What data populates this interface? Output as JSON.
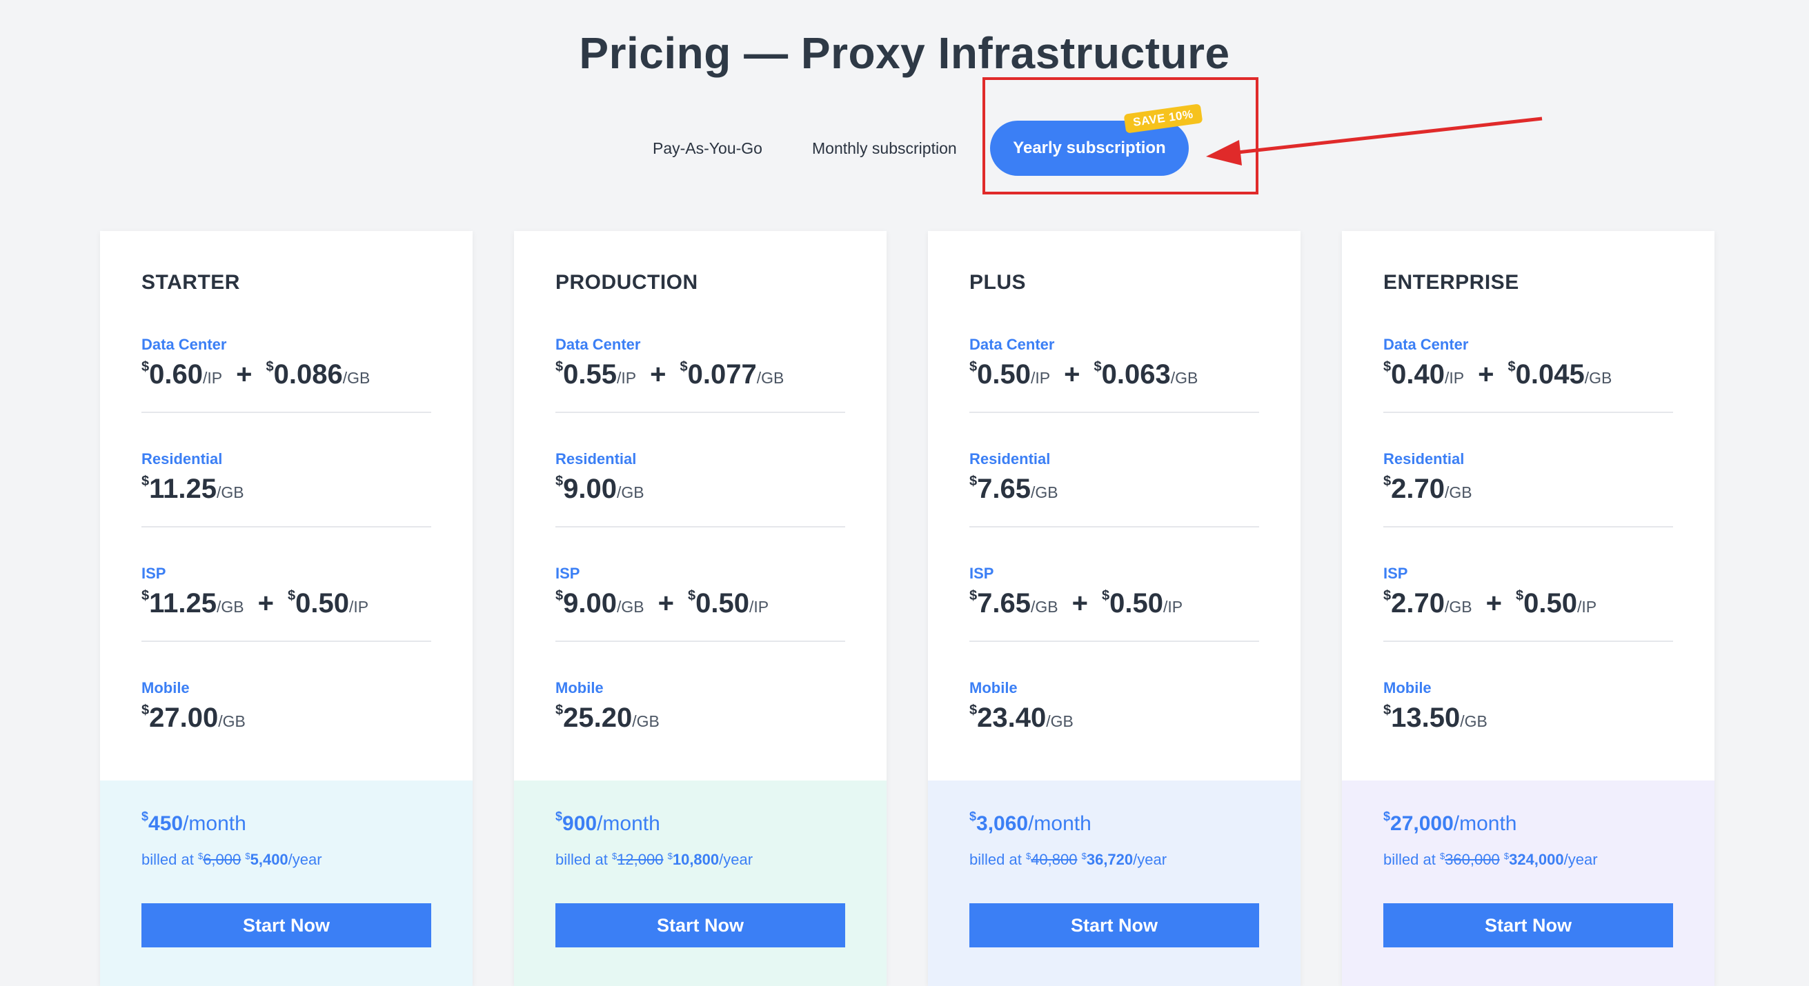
{
  "page": {
    "title": "Pricing — Proxy Infrastructure"
  },
  "tabs": {
    "payg": "Pay-As-You-Go",
    "monthly": "Monthly subscription",
    "yearly": "Yearly subscription",
    "badge": "SAVE 10%",
    "active": "yearly"
  },
  "colors": {
    "accent": "#3b7ff5",
    "badge": "#f6c21d",
    "annotation": "#e02a2a"
  },
  "labels": {
    "datacenter": "Data Center",
    "residential": "Residential",
    "isp": "ISP",
    "mobile": "Mobile",
    "currency": "$",
    "per_ip": "/IP",
    "per_gb": "/GB",
    "plus": "+",
    "per_month": "/month",
    "per_year": "/year",
    "billed_at": "billed at ",
    "cta": "Start Now"
  },
  "plans": [
    {
      "name": "STARTER",
      "bg": "#e8f7fb",
      "datacenter": {
        "ip": "0.60",
        "gb": "0.086"
      },
      "residential": {
        "gb": "11.25"
      },
      "isp": {
        "gb": "11.25",
        "ip": "0.50"
      },
      "mobile": {
        "gb": "27.00"
      },
      "monthly": "450",
      "old_year": "6,000",
      "new_year": "5,400"
    },
    {
      "name": "PRODUCTION",
      "bg": "#e6f8f3",
      "datacenter": {
        "ip": "0.55",
        "gb": "0.077"
      },
      "residential": {
        "gb": "9.00"
      },
      "isp": {
        "gb": "9.00",
        "ip": "0.50"
      },
      "mobile": {
        "gb": "25.20"
      },
      "monthly": "900",
      "old_year": "12,000",
      "new_year": "10,800"
    },
    {
      "name": "PLUS",
      "bg": "#eaf1fd",
      "datacenter": {
        "ip": "0.50",
        "gb": "0.063"
      },
      "residential": {
        "gb": "7.65"
      },
      "isp": {
        "gb": "7.65",
        "ip": "0.50"
      },
      "mobile": {
        "gb": "23.40"
      },
      "monthly": "3,060",
      "old_year": "40,800",
      "new_year": "36,720"
    },
    {
      "name": "ENTERPRISE",
      "bg": "#f1effd",
      "datacenter": {
        "ip": "0.40",
        "gb": "0.045"
      },
      "residential": {
        "gb": "2.70"
      },
      "isp": {
        "gb": "2.70",
        "ip": "0.50"
      },
      "mobile": {
        "gb": "13.50"
      },
      "monthly": "27,000",
      "old_year": "360,000",
      "new_year": "324,000"
    }
  ]
}
